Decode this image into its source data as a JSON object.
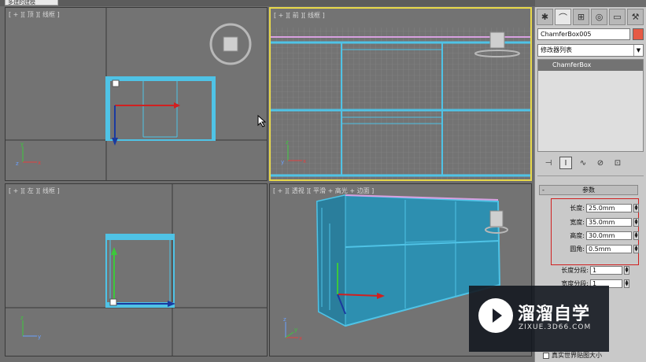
{
  "window": {
    "tab_label": "多建的建模"
  },
  "viewports": {
    "top": {
      "label": "[ + ][ 顶 ][ 线框 ]"
    },
    "front": {
      "label": "[ + ][ 前 ][ 线框 ]"
    },
    "left": {
      "label": "[ + ][ 左 ][ 线框 ]"
    },
    "persp": {
      "label": "[ + ][ 透视 ][ 平滑 + 高光 + 边面 ]"
    }
  },
  "panel": {
    "tabs": [
      "create-icon",
      "modify-icon",
      "hierarchy-icon",
      "motion-icon",
      "display-icon",
      "utilities-icon"
    ],
    "object_name": "ChamferBox005",
    "object_color": "#e65a45",
    "modifier_list": "修改器列表",
    "stack_item": "ChamferBox",
    "rollout_title": "参数",
    "params": [
      {
        "label": "长度:",
        "value": "25.0mm"
      },
      {
        "label": "宽度:",
        "value": "35.0mm"
      },
      {
        "label": "高度:",
        "value": "30.0mm"
      },
      {
        "label": "圆角:",
        "value": "0.5mm"
      }
    ],
    "segments": [
      {
        "label": "长度分段:",
        "value": "1"
      },
      {
        "label": "宽度分段:",
        "value": "1"
      }
    ],
    "checkbox_label": "真实世界贴图大小"
  },
  "watermark": {
    "cn": "溜溜自学",
    "en": "ZIXUE.3D66.COM"
  },
  "colors": {
    "wire": "#4fc3e6",
    "active_border": "#e8d84a",
    "grid": "#8a8a8a",
    "accent_red": "#d02020"
  }
}
